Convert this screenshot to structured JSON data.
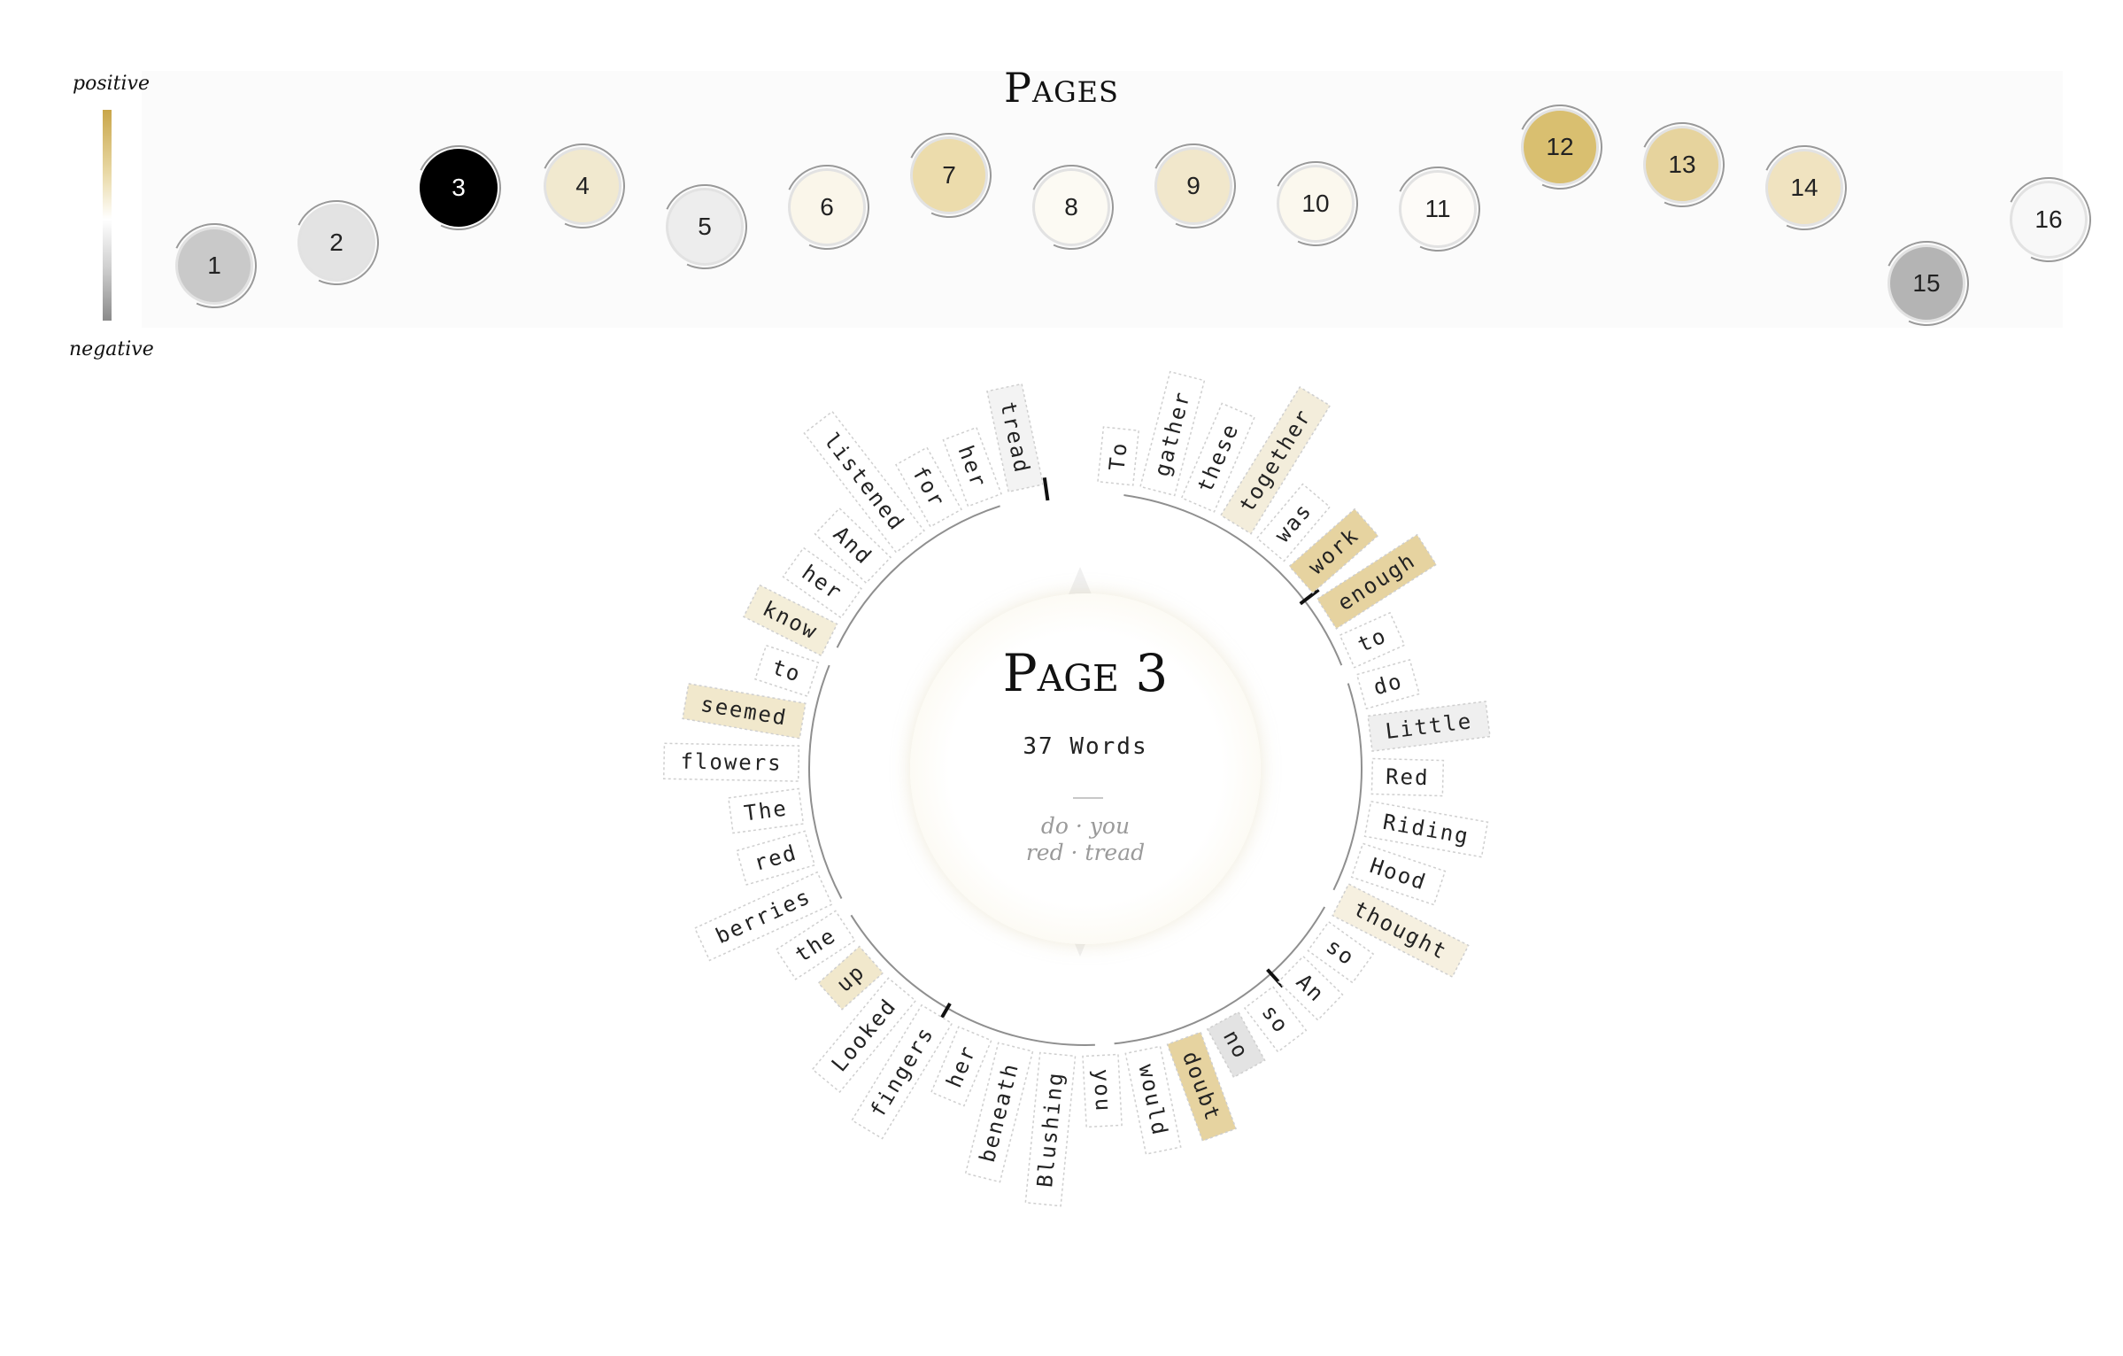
{
  "header": {
    "title": "Pages"
  },
  "legend": {
    "positive_label": "positive",
    "negative_label": "negative"
  },
  "pages": [
    {
      "label": "1",
      "fill": "#c9c9c9",
      "text_color": "#222222"
    },
    {
      "label": "2",
      "fill": "#e3e3e3",
      "text_color": "#222222"
    },
    {
      "label": "3",
      "fill": "#000000",
      "text_color": "#ffffff"
    },
    {
      "label": "4",
      "fill": "#f1e9cf",
      "text_color": "#222222"
    },
    {
      "label": "5",
      "fill": "#ededed",
      "text_color": "#222222"
    },
    {
      "label": "6",
      "fill": "#faf6ea",
      "text_color": "#222222"
    },
    {
      "label": "7",
      "fill": "#ecdcac",
      "text_color": "#222222"
    },
    {
      "label": "8",
      "fill": "#fcfaf3",
      "text_color": "#222222"
    },
    {
      "label": "9",
      "fill": "#f1e7cb",
      "text_color": "#222222"
    },
    {
      "label": "10",
      "fill": "#fbf8ee",
      "text_color": "#222222"
    },
    {
      "label": "11",
      "fill": "#fdfbf8",
      "text_color": "#222222"
    },
    {
      "label": "12",
      "fill": "#d9bf70",
      "text_color": "#222222"
    },
    {
      "label": "13",
      "fill": "#e6d39d",
      "text_color": "#222222"
    },
    {
      "label": "14",
      "fill": "#f0e3c0",
      "text_color": "#222222"
    },
    {
      "label": "15",
      "fill": "#b4b4b4",
      "text_color": "#222222"
    },
    {
      "label": "16",
      "fill": "#f8f8f8",
      "text_color": "#222222"
    }
  ],
  "selected_page": {
    "title": "Page 3",
    "word_count": "37 Words",
    "pair_1": "do · you",
    "pair_2": "red · tread"
  },
  "words": [
    {
      "text": "To",
      "fill": "#ffffff"
    },
    {
      "text": "gather",
      "fill": "#ffffff"
    },
    {
      "text": "these",
      "fill": "#ffffff"
    },
    {
      "text": "together",
      "fill": "#f3eddb"
    },
    {
      "text": "was",
      "fill": "#ffffff"
    },
    {
      "text": "work",
      "fill": "#e6d3a0"
    },
    {
      "text": "enough",
      "fill": "#e6d3a0"
    },
    {
      "text": "to",
      "fill": "#ffffff"
    },
    {
      "text": "do",
      "fill": "#ffffff"
    },
    {
      "text": "Little",
      "fill": "#efefef"
    },
    {
      "text": "Red",
      "fill": "#ffffff"
    },
    {
      "text": "Riding",
      "fill": "#ffffff"
    },
    {
      "text": "Hood",
      "fill": "#ffffff"
    },
    {
      "text": "thought",
      "fill": "#f6f0e0"
    },
    {
      "text": "so",
      "fill": "#ffffff"
    },
    {
      "text": "An",
      "fill": "#ffffff"
    },
    {
      "text": "so",
      "fill": "#ffffff"
    },
    {
      "text": "no",
      "fill": "#e3e3e3"
    },
    {
      "text": "doubt",
      "fill": "#e6d3a0"
    },
    {
      "text": "would",
      "fill": "#ffffff"
    },
    {
      "text": "you",
      "fill": "#ffffff"
    },
    {
      "text": "Blushing",
      "fill": "#ffffff"
    },
    {
      "text": "beneath",
      "fill": "#ffffff"
    },
    {
      "text": "her",
      "fill": "#ffffff"
    },
    {
      "text": "fingers",
      "fill": "#ffffff"
    },
    {
      "text": "Looked",
      "fill": "#ffffff"
    },
    {
      "text": "up",
      "fill": "#f1e8cc"
    },
    {
      "text": "the",
      "fill": "#ffffff"
    },
    {
      "text": "berries",
      "fill": "#ffffff"
    },
    {
      "text": "red",
      "fill": "#ffffff"
    },
    {
      "text": "The",
      "fill": "#ffffff"
    },
    {
      "text": "flowers",
      "fill": "#ffffff"
    },
    {
      "text": "seemed",
      "fill": "#f1e8cc"
    },
    {
      "text": "to",
      "fill": "#ffffff"
    },
    {
      "text": "know",
      "fill": "#f4eed9"
    },
    {
      "text": "her",
      "fill": "#ffffff"
    },
    {
      "text": "And",
      "fill": "#ffffff"
    },
    {
      "text": "listened",
      "fill": "#ffffff"
    },
    {
      "text": "for",
      "fill": "#ffffff"
    },
    {
      "text": "her",
      "fill": "#ffffff"
    },
    {
      "text": "tread",
      "fill": "#f3f3f3"
    }
  ],
  "colors": {
    "positive": "#c9a649",
    "negative": "#8a8a8a",
    "neutral": "#ffffff"
  }
}
